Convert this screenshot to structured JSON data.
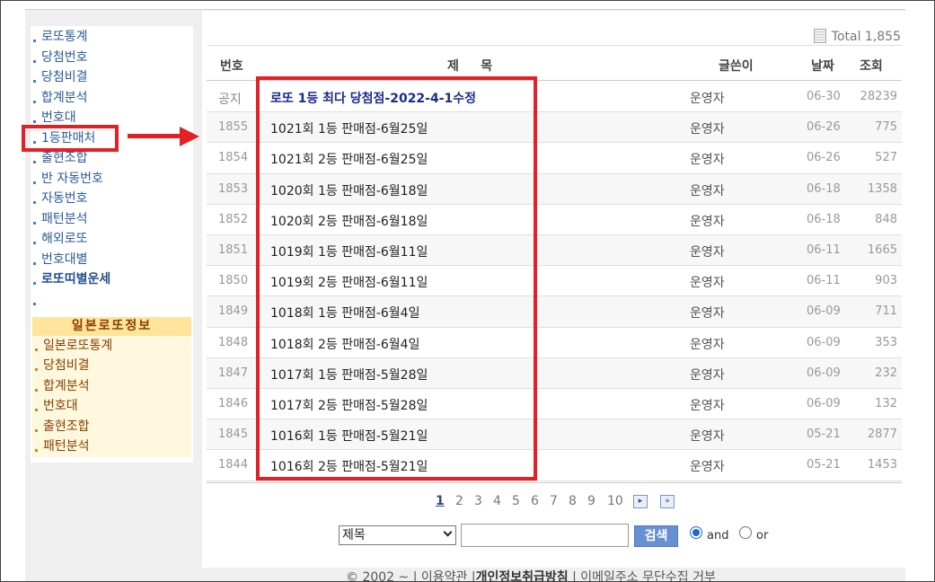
{
  "sidebar": {
    "menu": [
      "로또통계",
      "당첨번호",
      "당첨비결",
      "합계분석",
      "번호대",
      "1등판매처",
      "출현조합",
      "반 자동번호",
      "자동번호",
      "패턴분석",
      "해외로또",
      "번호대별"
    ],
    "fortune": "로또띠별운세",
    "japan": {
      "title": "일본로또정보",
      "items": [
        "일본로또통계",
        "당첨비결",
        "합계분석",
        "번호대",
        "출현조합",
        "패턴분석"
      ]
    }
  },
  "board": {
    "total": "Total 1,855",
    "headers": {
      "num": "번호",
      "title": "제     목",
      "author": "글쓴이",
      "date": "날짜",
      "views": "조회"
    },
    "notice": {
      "num": "공지",
      "title": "로또 1등 최다 당첨점-2022-4-1수정",
      "author": "운영자",
      "date": "06-30",
      "views": "28239"
    },
    "rows": [
      {
        "num": "1855",
        "title": "1021회 1등 판매점-6월25일",
        "author": "운영자",
        "date": "06-26",
        "views": "775"
      },
      {
        "num": "1854",
        "title": "1021회 2등 판매점-6월25일",
        "author": "운영자",
        "date": "06-26",
        "views": "527"
      },
      {
        "num": "1853",
        "title": "1020회 1등 판매점-6월18일",
        "author": "운영자",
        "date": "06-18",
        "views": "1358"
      },
      {
        "num": "1852",
        "title": "1020회 2등 판매점-6월18일",
        "author": "운영자",
        "date": "06-18",
        "views": "848"
      },
      {
        "num": "1851",
        "title": "1019회 1등 판매점-6월11일",
        "author": "운영자",
        "date": "06-11",
        "views": "1665"
      },
      {
        "num": "1850",
        "title": "1019회 2등 판매점-6월11일",
        "author": "운영자",
        "date": "06-11",
        "views": "903"
      },
      {
        "num": "1849",
        "title": "1018회 1등 판매점-6월4일",
        "author": "운영자",
        "date": "06-09",
        "views": "711"
      },
      {
        "num": "1848",
        "title": "1018회 2등 판매점-6월4일",
        "author": "운영자",
        "date": "06-09",
        "views": "353"
      },
      {
        "num": "1847",
        "title": "1017회 1등 판매점-5월28일",
        "author": "운영자",
        "date": "06-09",
        "views": "232"
      },
      {
        "num": "1846",
        "title": "1017회 2등 판매점-5월28일",
        "author": "운영자",
        "date": "06-09",
        "views": "132"
      },
      {
        "num": "1845",
        "title": "1016회 1등 판매점-5월21일",
        "author": "운영자",
        "date": "05-21",
        "views": "2877"
      },
      {
        "num": "1844",
        "title": "1016회 2등 판매점-5월21일",
        "author": "운영자",
        "date": "05-21",
        "views": "1453"
      }
    ]
  },
  "pagination": {
    "pages": [
      "1",
      "2",
      "3",
      "4",
      "5",
      "6",
      "7",
      "8",
      "9",
      "10"
    ],
    "current": "1",
    "next_icon": "next-page-icon",
    "last_icon": "last-page-icon"
  },
  "search": {
    "select_value": "제목",
    "input_value": "",
    "button_label": "검색",
    "and_label": "and",
    "or_label": "or"
  },
  "footer": {
    "copyright": "© 2002 ~",
    "terms": "이용약관",
    "privacy": "개인정보취급방침",
    "email": "이메일주소 무단수집 거부"
  },
  "annotation_color": "#e32026"
}
